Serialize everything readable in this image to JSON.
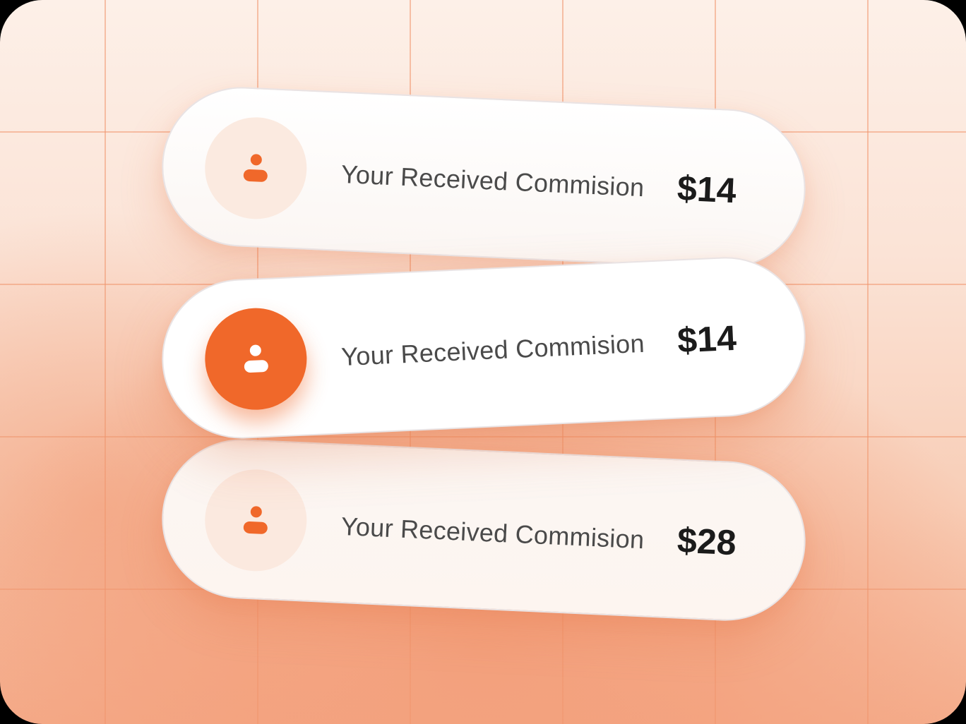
{
  "colors": {
    "accent": "#f0682a",
    "avatar_bg": "#fbeae0",
    "card_bg": "#ffffff",
    "text": "#4a4a4a",
    "amount_text": "#1b1b1b"
  },
  "commissions": [
    {
      "label": "Your Received Commision",
      "amount": "$14",
      "icon": "user-icon",
      "active": false
    },
    {
      "label": "Your Received Commision",
      "amount": "$14",
      "icon": "user-icon",
      "active": true
    },
    {
      "label": "Your Received Commision",
      "amount": "$28",
      "icon": "user-icon",
      "active": false
    }
  ]
}
